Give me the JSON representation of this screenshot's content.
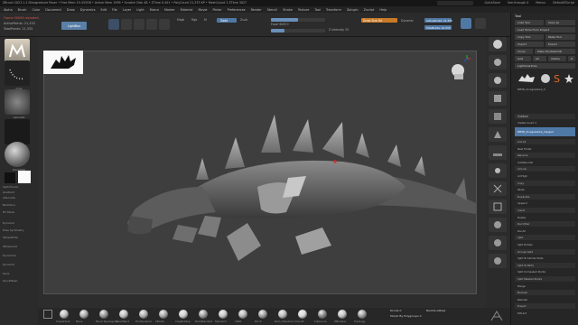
{
  "titlebar": {
    "title": "ZBrush 2021.1.1   Dinogreature Poser   • Free Mem 19.433GB • Active Mem 1999 • Scratch Disk 48 • ZTime 0.401 • PolyCount 21,333 KP • MeshCount 1   ZTime 3027",
    "right_items": [
      "QuickSave",
      "See-through 0",
      "Menus",
      "DefaultZScript"
    ]
  },
  "menu": [
    "Alpha",
    "Brush",
    "Color",
    "Document",
    "Draw",
    "Dynamics",
    "Edit",
    "File",
    "Layer",
    "Light",
    "Macro",
    "Marker",
    "Material",
    "Movie",
    "Picker",
    "Preferences",
    "Render",
    "Stencil",
    "Stroke",
    "Texture",
    "Tool",
    "Transform",
    "Zplugin",
    "Zscript",
    "Help"
  ],
  "toolbar": {
    "info_lines": [
      "Frame 00094 recorded.",
      "ActivePoints: 21,333",
      "TotalPoints: 21,333"
    ],
    "lightbox": "LightBox",
    "mrgb": "Mrgb",
    "rgb": "Rgb",
    "m": "M",
    "zadd": "Zadd",
    "zsub": "Zsub",
    "focal_shift": "Focal Shift 0",
    "draw_size": "Draw Size 64",
    "z_intensity": "Z Intensity 25",
    "dynamic": "Dynamic",
    "active_points": "ActivePoints: 21,333",
    "total_points": "TotalPoints: 21,333"
  },
  "leftpanel": {
    "labels": [
      "Standard",
      "Dots",
      "AlphaOff",
      "TextureOff",
      "BasicMat",
      "SwitchColor",
      "Gradient",
      "Alternate",
      "Backface",
      "Fill Mode",
      "Dynamic",
      "Pose Symmetry",
      "SPoseWrite",
      "SPoseLoad",
      "Dynamics",
      "Dynamic",
      "Save",
      "QuickMesh"
    ]
  },
  "toolpanel": {
    "title": "Tool",
    "buttons": [
      [
        "Load Tool",
        "Save As"
      ],
      [
        "Load Tools From Project"
      ],
      [
        "Copy Tool",
        "Paste Tool"
      ],
      [
        "Import",
        "Export"
      ],
      [
        "Clone",
        "Make PolyMesh3D"
      ],
      [
        "GoZ",
        "All",
        "Visible",
        "R"
      ],
      [
        "Lightbox▸Tools"
      ]
    ],
    "thumb_label": "PM3D_dinogreature_5",
    "subtool_header": "Subtool",
    "subtool_rows": [
      "Visible Count 1",
      "PM3D_dinogreature_merged"
    ],
    "list_rows": [
      "List All",
      "New Folder",
      "Rename",
      "AutoReorder",
      "All Low",
      "All High",
      "Copy",
      "Paste",
      "Duplicate",
      "Append",
      "Insert",
      "Delete",
      "Del Other",
      "Del All",
      "Split",
      "Split Hidden",
      "Groups Split",
      "Split To Similar Parts",
      "Split To Parts",
      "Split Unmasked Points",
      "Split Masked Points",
      "Merge",
      "Boolean",
      "Remesh",
      "Project",
      "Extract"
    ]
  },
  "bottombar": {
    "labels": [
      "SnakeHook",
      "Move",
      "Move Topological",
      "SelectRect",
      "TrimDynamic",
      "hPolish",
      "ClayBuildup",
      "DamStandard",
      "Standard",
      "Inflat",
      "Pinch",
      "Dam_Standard",
      "Smooth",
      "ClipCurve",
      "ZModeler",
      "Topology"
    ],
    "divide": "Divide 0",
    "morph": "Morph By Polygroups 0",
    "backface": "BackfaceMask"
  },
  "colors": {
    "accent_blue": "#4f78a5",
    "accent_orange": "#c87a28",
    "canvas": "#3e3e3e",
    "panel": "#2b2b2b"
  }
}
